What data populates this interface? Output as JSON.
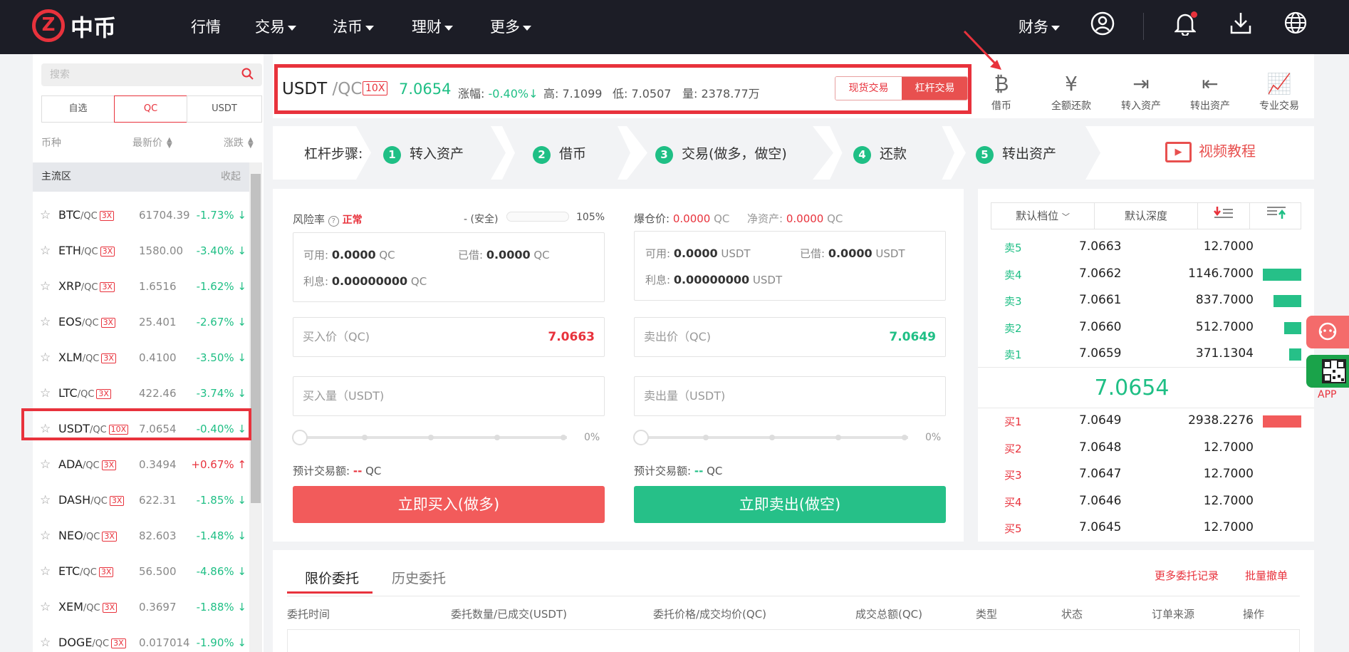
{
  "nav": {
    "logo_glyph": "Z",
    "logo_text": "中币",
    "items": [
      "行情",
      "交易",
      "法币",
      "理财",
      "更多"
    ],
    "finance": "财务"
  },
  "sidebar": {
    "search_placeholder": "搜索",
    "segments": [
      "自选",
      "QC",
      "USDT"
    ],
    "active_segment": "QC",
    "columns": [
      "币种",
      "最新价",
      "涨跌"
    ],
    "zone_label": "主流区",
    "zone_action": "收起",
    "rows": [
      {
        "coin": "BTC",
        "quote": "/QC",
        "lev": "3X",
        "price": "61704.39",
        "change": "-1.73%",
        "arrow": "↓",
        "up": false
      },
      {
        "coin": "ETH",
        "quote": "/QC",
        "lev": "3X",
        "price": "1580.00",
        "change": "-3.40%",
        "arrow": "↓",
        "up": false
      },
      {
        "coin": "XRP",
        "quote": "/QC",
        "lev": "3X",
        "price": "1.6516",
        "change": "-1.62%",
        "arrow": "↓",
        "up": false
      },
      {
        "coin": "EOS",
        "quote": "/QC",
        "lev": "3X",
        "price": "25.401",
        "change": "-2.67%",
        "arrow": "↓",
        "up": false
      },
      {
        "coin": "XLM",
        "quote": "/QC",
        "lev": "3X",
        "price": "0.4100",
        "change": "-3.50%",
        "arrow": "↓",
        "up": false
      },
      {
        "coin": "LTC",
        "quote": "/QC",
        "lev": "3X",
        "price": "422.46",
        "change": "-3.74%",
        "arrow": "↓",
        "up": false
      },
      {
        "coin": "USDT",
        "quote": "/QC",
        "lev": "10X",
        "price": "7.0654",
        "change": "-0.40%",
        "arrow": "↓",
        "up": false
      },
      {
        "coin": "ADA",
        "quote": "/QC",
        "lev": "3X",
        "price": "0.3494",
        "change": "+0.67%",
        "arrow": "↑",
        "up": true
      },
      {
        "coin": "DASH",
        "quote": "/QC",
        "lev": "3X",
        "price": "622.31",
        "change": "-1.85%",
        "arrow": "↓",
        "up": false
      },
      {
        "coin": "NEO",
        "quote": "/QC",
        "lev": "3X",
        "price": "82.603",
        "change": "-1.48%",
        "arrow": "↓",
        "up": false
      },
      {
        "coin": "ETC",
        "quote": "/QC",
        "lev": "3X",
        "price": "56.500",
        "change": "-4.86%",
        "arrow": "↓",
        "up": false
      },
      {
        "coin": "XEM",
        "quote": "/QC",
        "lev": "3X",
        "price": "0.3697",
        "change": "-1.88%",
        "arrow": "↓",
        "up": false
      },
      {
        "coin": "DOGE",
        "quote": "/QC",
        "lev": "3X",
        "price": "0.017014",
        "change": "-1.90%",
        "arrow": "↓",
        "up": false
      }
    ]
  },
  "header": {
    "coin": "USDT",
    "quote": "/QC",
    "leverage": "10X",
    "price": "7.0654",
    "change_label": "涨幅:",
    "change": "-0.40%↓",
    "high": "高: 7.1099",
    "low": "低: 7.0507",
    "volume": "量: 2378.77万",
    "mode_spot": "现货交易",
    "mode_margin": "杠杆交易",
    "actions": [
      {
        "icon": "borrow-icon",
        "glyph": "₿",
        "label": "借币"
      },
      {
        "icon": "repay-icon",
        "glyph": "¥",
        "label": "全额还款"
      },
      {
        "icon": "transfer-in-icon",
        "glyph": "⇥",
        "label": "转入资产"
      },
      {
        "icon": "transfer-out-icon",
        "glyph": "⇤",
        "label": "转出资产"
      },
      {
        "icon": "pro-trade-icon",
        "glyph": "📈",
        "label": "专业交易"
      }
    ]
  },
  "steps": {
    "label": "杠杆步骤:",
    "items": [
      {
        "n": "1",
        "t": "转入资产"
      },
      {
        "n": "2",
        "t": "借币"
      },
      {
        "n": "3",
        "t": "交易(做多，做空)"
      },
      {
        "n": "4",
        "t": "还款"
      },
      {
        "n": "5",
        "t": "转出资产"
      }
    ],
    "video": "视频教程"
  },
  "buy": {
    "risk_label": "风险率",
    "risk_status": "正常",
    "risk_safe": "- (安全)",
    "risk_pct": "105%",
    "available_label": "可用:",
    "available": "0.0000",
    "borrowed_label": "已借:",
    "borrowed": "0.0000",
    "interest_label": "利息:",
    "interest": "0.00000000",
    "unit": "QC",
    "price_placeholder": "买入价（QC)",
    "price_value": "7.0663",
    "amount_placeholder": "买入量（USDT)",
    "slider_pct": "0%",
    "est_label": "预计交易额:",
    "est_value": "--",
    "est_unit": "QC",
    "button": "立即买入(做多)"
  },
  "sell": {
    "liq_label": "爆仓价:",
    "liq_value": "0.0000",
    "liq_unit": "QC",
    "net_label": "净资产:",
    "net_value": "0.0000",
    "net_unit": "QC",
    "available_label": "可用:",
    "available": "0.0000",
    "borrowed_label": "已借:",
    "borrowed": "0.0000",
    "interest_label": "利息:",
    "interest": "0.00000000",
    "unit": "USDT",
    "price_placeholder": "卖出价（QC)",
    "price_value": "7.0649",
    "amount_placeholder": "卖出量（USDT)",
    "slider_pct": "0%",
    "est_label": "预计交易额:",
    "est_value": "--",
    "est_unit": "QC",
    "button": "立即卖出(做空)"
  },
  "book": {
    "tabs": [
      "默认档位",
      "默认深度"
    ],
    "asks": [
      {
        "l": "卖5",
        "p": "7.0663",
        "q": "12.7000",
        "depth": 0
      },
      {
        "l": "卖4",
        "p": "7.0662",
        "q": "1146.7000",
        "depth": 1.0
      },
      {
        "l": "卖3",
        "p": "7.0661",
        "q": "837.7000",
        "depth": 0.73
      },
      {
        "l": "卖2",
        "p": "7.0660",
        "q": "512.7000",
        "depth": 0.45
      },
      {
        "l": "卖1",
        "p": "7.0659",
        "q": "371.1304",
        "depth": 0.32
      }
    ],
    "mid": "7.0654",
    "bids": [
      {
        "l": "买1",
        "p": "7.0649",
        "q": "2938.2276",
        "depth": 1.0
      },
      {
        "l": "买2",
        "p": "7.0648",
        "q": "12.7000",
        "depth": 0
      },
      {
        "l": "买3",
        "p": "7.0647",
        "q": "12.7000",
        "depth": 0
      },
      {
        "l": "买4",
        "p": "7.0646",
        "q": "12.7000",
        "depth": 0
      },
      {
        "l": "买5",
        "p": "7.0645",
        "q": "12.7000",
        "depth": 0
      }
    ]
  },
  "orders": {
    "tabs": [
      "限价委托",
      "历史委托"
    ],
    "more": "更多委托记录",
    "batch_cancel": "批量撤单",
    "columns": [
      "委托时间",
      "委托数量/已成交(USDT)",
      "委托价格/成交均价(QC)",
      "成交总额(QC)",
      "类型",
      "状态",
      "订单来源",
      "操作"
    ]
  },
  "float": {
    "app": "APP"
  },
  "colors": {
    "red": "#e8323c",
    "green": "#1fbf85",
    "nav_bg": "#1c1d26"
  }
}
